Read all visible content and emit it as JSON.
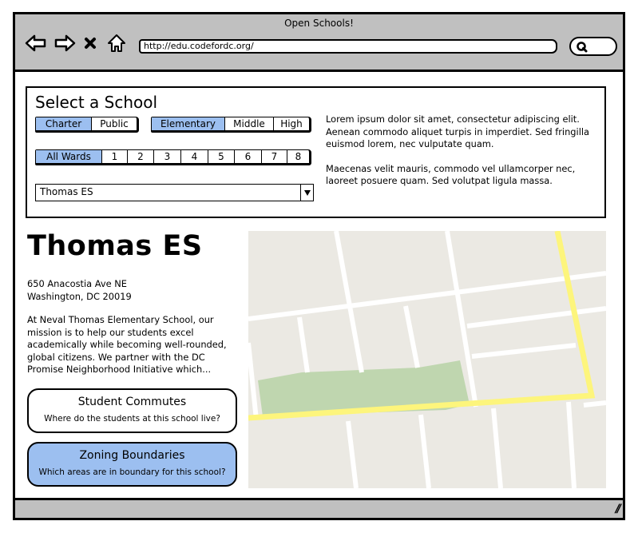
{
  "browser": {
    "title": "Open Schools!",
    "url": "http://edu.codefordc.org/",
    "icons": {
      "back": "arrow-left-icon",
      "forward": "arrow-right-icon",
      "stop": "close-x-icon",
      "home": "home-icon",
      "search": "search-icon",
      "resize": "resize-grip-icon"
    }
  },
  "selector": {
    "title": "Select a School",
    "school_type": {
      "options": [
        "Charter",
        "Public"
      ],
      "selected": "Charter"
    },
    "grade_level": {
      "options": [
        "Elementary",
        "Middle",
        "High"
      ],
      "selected": "Elementary"
    },
    "wards": {
      "options": [
        "All Wards",
        "1",
        "2",
        "3",
        "4",
        "5",
        "6",
        "7",
        "8"
      ],
      "selected": "All Wards"
    },
    "school_dropdown": {
      "value": "Thomas ES"
    },
    "description": [
      "Lorem ipsum dolor sit amet, consectetur adipiscing elit. Aenean commodo aliquet turpis in imperdiet. Sed fringilla euismod lorem, nec vulputate quam.",
      "Maecenas velit mauris, commodo vel ullamcorper nec, laoreet posuere quam. Sed volutpat ligula massa."
    ]
  },
  "school": {
    "name": "Thomas ES",
    "address_line1": "650 Anacostia Ave NE",
    "address_line2": "Washington, DC 20019",
    "blurb": "At Neval Thomas Elementary School, our mission is to help our students excel academically while becoming well-rounded, global citizens. We partner with the DC Promise Neighborhood Initiative which..."
  },
  "cards": [
    {
      "title": "Student Commutes",
      "subtitle": "Where do the students at this school live?",
      "active": false
    },
    {
      "title": "Zoning Boundaries",
      "subtitle": "Which areas are in boundary for this school?",
      "active": true
    }
  ],
  "map": {
    "colors": {
      "land": "#ebe9e3",
      "road": "#ffffff",
      "park": "#bfd6af",
      "boundary": "#fdf57c"
    }
  },
  "theme": {
    "chrome": "#c0c0c0",
    "selected": "#9cbff0"
  }
}
